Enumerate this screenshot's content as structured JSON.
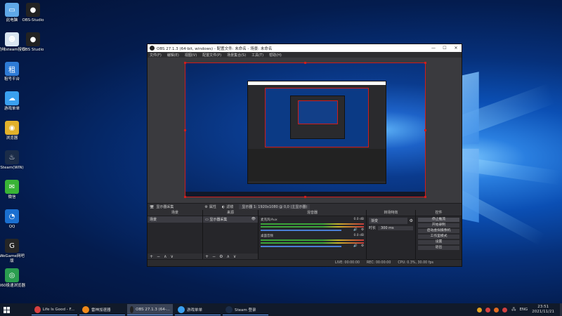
{
  "desktop": {
    "icons": [
      {
        "label": "此电脑",
        "name": "this-pc-icon",
        "color": "#5fa8e8"
      },
      {
        "label": "OBS-Studio",
        "name": "obs-icon",
        "color": "#222222"
      },
      {
        "label": "韵味steam授权",
        "name": "steam-auth-icon",
        "color": "#d8e4f0"
      },
      {
        "label": "OBS Studio",
        "name": "obs-studio-icon",
        "color": "#222222"
      },
      {
        "label": "租号平台",
        "name": "rental-platform-icon",
        "color": "#2e7bd6"
      },
      {
        "label": "游戏单单",
        "name": "game-list-icon",
        "color": "#3aa0ef"
      },
      {
        "label": "浏览器",
        "name": "browser-icon",
        "color": "#e2b12b"
      },
      {
        "label": "Steam(WIN)",
        "name": "steam-icon",
        "color": "#1b2c48"
      },
      {
        "label": "微信",
        "name": "wechat-icon",
        "color": "#39b436"
      },
      {
        "label": "QQ",
        "name": "qq-icon",
        "color": "#1a6fd0"
      },
      {
        "label": "WeGame网吧版",
        "name": "wegame-icon",
        "color": "#262626"
      },
      {
        "label": "360极速浏览器",
        "name": "browser-360-icon",
        "color": "#2a9d4f"
      }
    ]
  },
  "obs": {
    "title": "OBS 27.1.3 (64-bit, windows) - 配置文件: 未命名 - 场景: 未命名",
    "menu": [
      "文件(F)",
      "编辑(E)",
      "视图(V)",
      "配置文件(P)",
      "场景集合(S)",
      "工具(T)",
      "帮助(H)"
    ],
    "source_toolbar": {
      "source_name": "显示器采集",
      "properties": "属性",
      "filters": "滤镜",
      "display": "显示器 1: 1920x1080 @ 0,0 (主显示器)"
    },
    "docks": {
      "scenes": {
        "title": "场景",
        "items": [
          "场景"
        ]
      },
      "sources": {
        "title": "来源",
        "items": [
          "显示器采集"
        ]
      },
      "mixer": {
        "title": "混音器",
        "channels": [
          {
            "name": "麦克风/Aux",
            "db": "0.0 dB"
          },
          {
            "name": "桌面音频",
            "db": "0.0 dB"
          }
        ]
      },
      "transitions": {
        "title": "转场特效",
        "type": "渐变",
        "duration_label": "时长",
        "duration": "300 ms"
      },
      "controls": {
        "title": "控件",
        "buttons": [
          "停止推流",
          "开始录制",
          "启动虚拟摄像机",
          "工作室模式",
          "设置",
          "退出"
        ]
      }
    },
    "status": {
      "live": "LIVE: 00:00:00",
      "rec": "REC: 00:00:00",
      "cpu": "CPU: 0.3%, 30.00 fps"
    }
  },
  "taskbar": {
    "items": [
      {
        "label": "Life Is Good - F...",
        "color": "#d64040"
      },
      {
        "label": "雷神加速器",
        "color": "#f08a1a"
      },
      {
        "label": "OBS 27.1.3 (64-...",
        "color": "#222222",
        "active": true
      },
      {
        "label": "游戏单单",
        "color": "#3aa0ef"
      },
      {
        "label": "Steam 登录",
        "color": "#1b2c48"
      }
    ],
    "lang": "ENG",
    "time": "23:51",
    "date": "2021/11/21"
  }
}
